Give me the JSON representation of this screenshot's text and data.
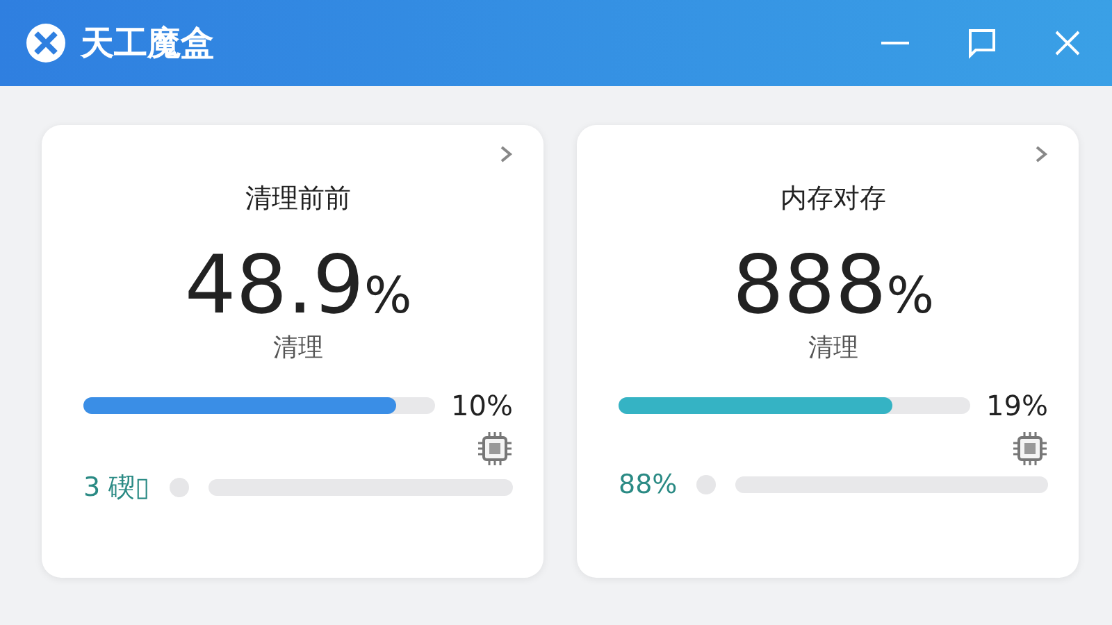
{
  "window": {
    "title": "天工魔盒"
  },
  "cards": [
    {
      "title": "清理前前",
      "value": "48.9",
      "unit": "%",
      "caption": "清理",
      "bar": {
        "level": 0.89,
        "color": "#3a8ee6",
        "reading": "10%"
      },
      "sub": {
        "label": "3 碶▯"
      }
    },
    {
      "title": "内存对存",
      "value": "888",
      "unit": "%",
      "caption": "清理",
      "bar": {
        "level": 0.78,
        "color": "#35b3c4",
        "reading": "19%"
      },
      "sub": {
        "label": "88%"
      }
    }
  ]
}
